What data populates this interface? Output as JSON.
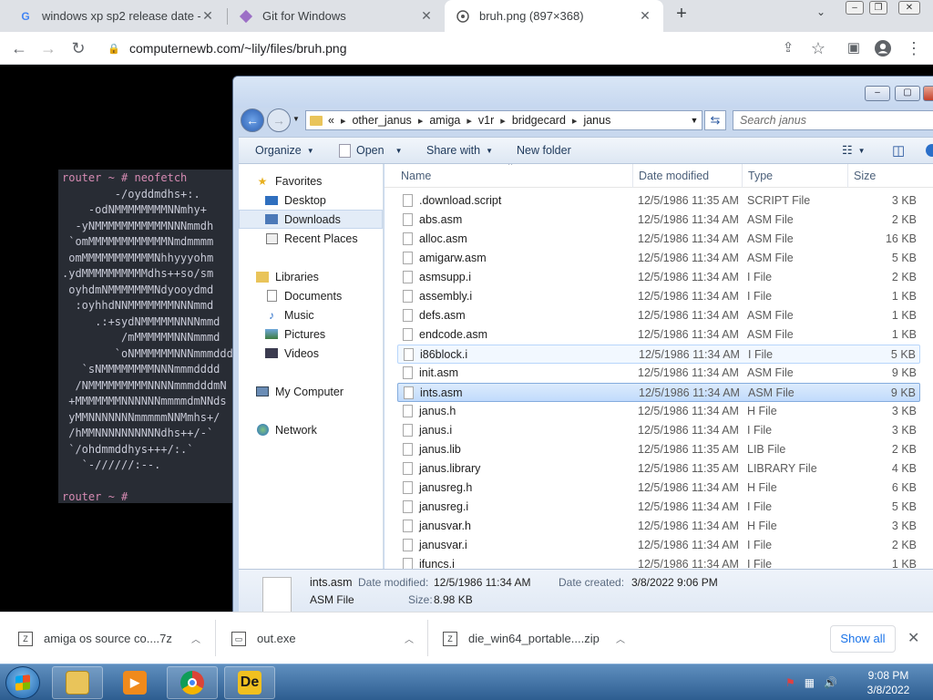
{
  "browser": {
    "tabs": [
      {
        "title": "windows xp sp2 release date - G",
        "icon": "google-icon"
      },
      {
        "title": "Git for Windows",
        "icon": "git-icon"
      },
      {
        "title": "bruh.png (897×368)",
        "icon": "image-icon",
        "active": true
      }
    ],
    "url": "computernewb.com/~lily/files/bruh.png"
  },
  "terminal": {
    "lines": [
      "router ~ # neofetch",
      "        -/oyddmdhs+:.",
      "    -odNMMMMMMMMNNmhy+",
      "  -yNMMMMMMMMMMMNNNmmdh",
      " `omMMMMMMMMMMMMNmdmmmm",
      " omMMMMMMMMMMMNhhyyyohm",
      ".ydMMMMMMMMMMdhs++so/sm",
      " oyhdmNMMMMMMMNdyooydmd",
      "  :oyhhdNNMMMMMMMNNNmmd",
      "     .:+sydNMMMMMNNNNmmd",
      "         /mMMMMMMNNNmmmd",
      "        `oNMMMMMMNNNmmmddd",
      "   `sNMMMMMMMMNNNmmmdddd",
      "  /NMMMMMMMMMNNNNmmmdddmN",
      " +MMMMMMMNNNNNNmmmmdmNNds",
      " yMMNNNNNNNmmmmmNNMmhs+/",
      " /hMMNNNNNNNNNNdhs++/-`",
      " `/ohdmmddhys+++/:.`",
      "   `-//////:--.",
      "",
      "router ~ #"
    ]
  },
  "explorer": {
    "breadcrumb": [
      "other_janus",
      "amiga",
      "v1r",
      "bridgecard",
      "janus"
    ],
    "breadcrumb_prefix": "«",
    "search_placeholder": "Search janus",
    "toolbar": {
      "organize": "Organize",
      "open": "Open",
      "share": "Share with",
      "new_folder": "New folder"
    },
    "nav": {
      "favorites": "Favorites",
      "desktop": "Desktop",
      "downloads": "Downloads",
      "recent": "Recent Places",
      "libraries": "Libraries",
      "documents": "Documents",
      "music": "Music",
      "pictures": "Pictures",
      "videos": "Videos",
      "computer": "My Computer",
      "network": "Network"
    },
    "columns": {
      "name": "Name",
      "date": "Date modified",
      "type": "Type",
      "size": "Size"
    },
    "files": [
      {
        "name": ".download.script",
        "date": "12/5/1986 11:35 AM",
        "type": "SCRIPT File",
        "size": "3 KB"
      },
      {
        "name": "abs.asm",
        "date": "12/5/1986 11:34 AM",
        "type": "ASM File",
        "size": "2 KB"
      },
      {
        "name": "alloc.asm",
        "date": "12/5/1986 11:34 AM",
        "type": "ASM File",
        "size": "16 KB"
      },
      {
        "name": "amigarw.asm",
        "date": "12/5/1986 11:34 AM",
        "type": "ASM File",
        "size": "5 KB"
      },
      {
        "name": "asmsupp.i",
        "date": "12/5/1986 11:34 AM",
        "type": "I File",
        "size": "2 KB"
      },
      {
        "name": "assembly.i",
        "date": "12/5/1986 11:34 AM",
        "type": "I File",
        "size": "1 KB"
      },
      {
        "name": "defs.asm",
        "date": "12/5/1986 11:34 AM",
        "type": "ASM File",
        "size": "1 KB"
      },
      {
        "name": "endcode.asm",
        "date": "12/5/1986 11:34 AM",
        "type": "ASM File",
        "size": "1 KB"
      },
      {
        "name": "i86block.i",
        "date": "12/5/1986 11:34 AM",
        "type": "I File",
        "size": "5 KB"
      },
      {
        "name": "init.asm",
        "date": "12/5/1986 11:34 AM",
        "type": "ASM File",
        "size": "9 KB"
      },
      {
        "name": "ints.asm",
        "date": "12/5/1986 11:34 AM",
        "type": "ASM File",
        "size": "9 KB"
      },
      {
        "name": "janus.h",
        "date": "12/5/1986 11:34 AM",
        "type": "H File",
        "size": "3 KB"
      },
      {
        "name": "janus.i",
        "date": "12/5/1986 11:34 AM",
        "type": "I File",
        "size": "3 KB"
      },
      {
        "name": "janus.lib",
        "date": "12/5/1986 11:35 AM",
        "type": "LIB File",
        "size": "2 KB"
      },
      {
        "name": "janus.library",
        "date": "12/5/1986 11:35 AM",
        "type": "LIBRARY File",
        "size": "4 KB"
      },
      {
        "name": "janusreg.h",
        "date": "12/5/1986 11:34 AM",
        "type": "H File",
        "size": "6 KB"
      },
      {
        "name": "janusreg.i",
        "date": "12/5/1986 11:34 AM",
        "type": "I File",
        "size": "5 KB"
      },
      {
        "name": "janusvar.h",
        "date": "12/5/1986 11:34 AM",
        "type": "H File",
        "size": "3 KB"
      },
      {
        "name": "janusvar.i",
        "date": "12/5/1986 11:34 AM",
        "type": "I File",
        "size": "2 KB"
      },
      {
        "name": "ifuncs.i",
        "date": "12/5/1986 11:34 AM",
        "type": "I File",
        "size": "1 KB"
      }
    ],
    "details": {
      "name": "ints.asm",
      "type": "ASM File",
      "modified_label": "Date modified:",
      "modified": "12/5/1986 11:34 AM",
      "created_label": "Date created:",
      "created": "3/8/2022 9:06 PM",
      "size_label": "Size:",
      "size": "8.98 KB"
    }
  },
  "downloads": {
    "items": [
      "amiga os source co....7z",
      "out.exe",
      "die_win64_portable....zip"
    ],
    "show_all": "Show all"
  },
  "taskbar": {
    "time": "9:08 PM",
    "date": "3/8/2022",
    "apps": [
      "explorer-icon",
      "media-player-icon",
      "chrome-icon",
      "detect-it-easy-icon"
    ]
  }
}
